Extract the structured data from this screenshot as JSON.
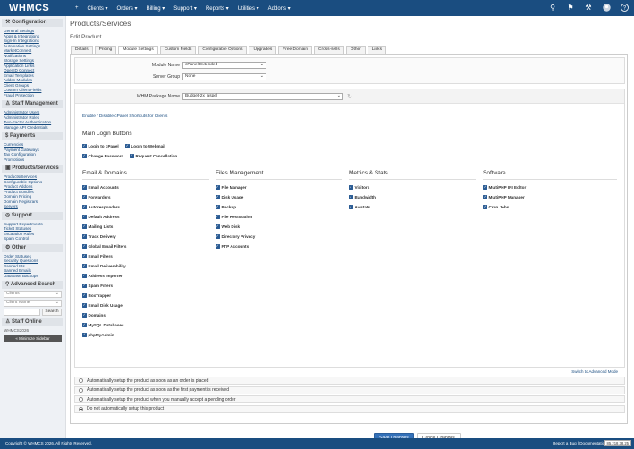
{
  "brand": {
    "logo": "WHMCS"
  },
  "topnav": {
    "items": [
      "+",
      "Clients ▾",
      "Orders ▾",
      "Billing ▾",
      "Support ▾",
      "Reports ▾",
      "Utilities ▾",
      "Addons ▾"
    ]
  },
  "topicons": [
    "search-icon",
    "notifications-icon",
    "wrench-icon",
    "avatar",
    "help-icon"
  ],
  "sidebar": {
    "sections": [
      {
        "title": "Configuration",
        "items": [
          "General Settings",
          "Apps & Integrations",
          "Sign-In Integrations",
          "Automation Settings",
          "MarketConnect",
          "Notifications",
          "Storage Settings",
          "Application Links",
          "OpenID Connect",
          "Email Templates",
          "Addon Modules",
          "Client Groups",
          "Custom Client Fields",
          "Fraud Protection"
        ]
      },
      {
        "title": "Staff Management",
        "items": [
          "Administrator Users",
          "Administrator Roles",
          "Two-Factor Authentication",
          "Manage API Credentials"
        ]
      },
      {
        "title": "Payments",
        "items": [
          "Currencies",
          "Payment Gateways",
          "Tax Configuration",
          "Promotions"
        ]
      },
      {
        "title": "Products/Services",
        "items": [
          "Products/Services",
          "Configurable Options",
          "Product Addons",
          "Product Bundles",
          "Domain Pricing",
          "Domain Registrars",
          "Servers"
        ]
      },
      {
        "title": "Support",
        "items": [
          "Support Departments",
          "Ticket Statuses",
          "Escalation Rules",
          "Spam Control"
        ]
      },
      {
        "title": "Other",
        "items": [
          "Order Statuses",
          "Security Questions",
          "Banned IPs",
          "Banned Emails",
          "Database Backups"
        ]
      }
    ],
    "advanced_search": {
      "title": "Advanced Search",
      "select1": "Clients",
      "select2": "Client Name",
      "button": "Search"
    },
    "staff_online": {
      "title": "Staff Online",
      "user": "WHMCS2026"
    },
    "minimize": "« Minimize Sidebar"
  },
  "page": {
    "title": "Products/Services",
    "subtitle": "Edit Product"
  },
  "tabs": [
    "Details",
    "Pricing",
    "Module Settings",
    "Custom Fields",
    "Configurable Options",
    "Upgrades",
    "Free Domain",
    "Cross-sells",
    "Other",
    "Links"
  ],
  "module": {
    "module_name_label": "Module Name",
    "module_name_value": "cPanel Extended",
    "server_group_label": "Server Group",
    "server_group_value": "None",
    "package_label": "WHM Package Name",
    "package_value": "Budget-2x_aspel",
    "toggle_link": "Enable / Disable cPanel Shortcuts for Clients",
    "main_login_title": "Main Login Buttons",
    "main_login": [
      "Login to cPanel",
      "Login to Webmail",
      "Change Password",
      "Request Cancellation"
    ],
    "groups": [
      {
        "title": "Email & Domains",
        "items": [
          "Email Accounts",
          "Forwarders",
          "Autoresponders",
          "Default Address",
          "Mailing Lists",
          "Track Delivery",
          "Global Email Filters",
          "Email Filters",
          "Email Deliverability",
          "Address Importer",
          "Spam Filters",
          "BoxTrapper",
          "Email Disk Usage",
          "Domains",
          "MySQL Databases",
          "phpMyAdmin"
        ]
      },
      {
        "title": "Files Management",
        "items": [
          "File Manager",
          "Disk Usage",
          "Backup",
          "File Restoration",
          "Web Disk",
          "Directory Privacy",
          "FTP Accounts"
        ]
      },
      {
        "title": "Metrics & Stats",
        "items": [
          "Visitors",
          "Bandwidth",
          "Awstats"
        ]
      },
      {
        "title": "Software",
        "items": [
          "MultiPHP INI Editor",
          "MultiPHP Manager",
          "Cron Jobs"
        ]
      }
    ],
    "advanced_link": "Switch to Advanced Mode"
  },
  "radios": [
    {
      "label": "Automatically setup the product as soon as an order is placed",
      "selected": false
    },
    {
      "label": "Automatically setup the product as soon as the first payment is received",
      "selected": false
    },
    {
      "label": "Automatically setup the product when you manually accept a pending order",
      "selected": false
    },
    {
      "label": "Do not automatically setup this product",
      "selected": true
    }
  ],
  "buttons": {
    "save": "Save Changes",
    "cancel": "Cancel Changes"
  },
  "footer": {
    "copyright": "Copyright © WHMCS 2026. All Rights Reserved.",
    "right": "Report a Bug | Documentation |",
    "ip": "85.218.38.25"
  },
  "colors": {
    "brand": "#1a4d80",
    "primary_button": "#3471b9",
    "checkbox": "#2a5b93"
  }
}
